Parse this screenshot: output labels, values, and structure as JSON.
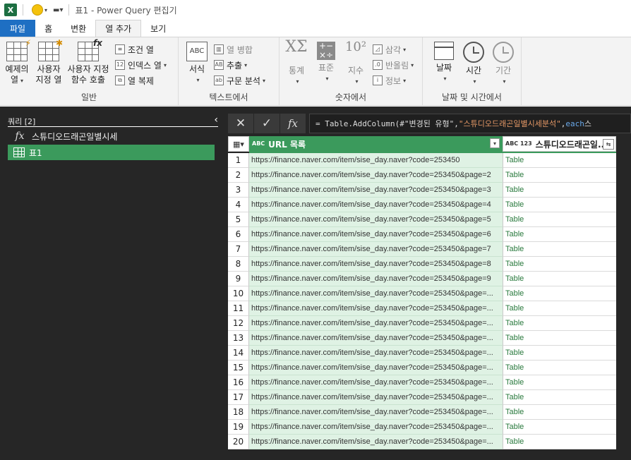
{
  "titlebar": {
    "app_icon": "X",
    "title": "표1 - Power Query 편집기"
  },
  "tabs": [
    {
      "label": "파일"
    },
    {
      "label": "홈"
    },
    {
      "label": "변환"
    },
    {
      "label": "열 추가"
    },
    {
      "label": "보기"
    }
  ],
  "ribbon": {
    "general": {
      "label": "일반",
      "example_col": [
        "예제의",
        "열"
      ],
      "custom_col": [
        "사용자",
        "지정 열"
      ],
      "invoke_func": [
        "사용자 지정",
        "함수 호출"
      ],
      "cond_col": "조건 열",
      "index_col": "인덱스 열",
      "dup_col": "열 복제"
    },
    "text": {
      "label": "텍스트에서",
      "format": "서식",
      "merge": "열 병합",
      "extract": "추출",
      "parse": "구문 분석",
      "abc_icon": "ABC"
    },
    "number": {
      "label": "숫자에서",
      "stats": "통계",
      "standard": "표준",
      "scientific": "지수",
      "trig": "삼각",
      "round": "반올림",
      "info": "정보",
      "sigma_icon": "XΣ",
      "pow_icon": "10²"
    },
    "datetime": {
      "label": "날짜 및 시간에서",
      "date": "날짜",
      "time": "시간",
      "duration": "기간"
    }
  },
  "queries": {
    "header": "쿼리 [2]",
    "items": [
      {
        "icon": "fx",
        "name": "스튜디오드래곤일별시세"
      },
      {
        "icon": "table",
        "name": "표1"
      }
    ]
  },
  "formula_bar": {
    "prefix": "= Table.AddColumn(#\"변경된 유형\", ",
    "string": "\"스튜디오드래곤일별시세분석\"",
    "sep": ", ",
    "keyword": "each",
    "suffix": " 스"
  },
  "grid": {
    "col1": {
      "type": "ABC",
      "name": "URL 목록"
    },
    "col2": {
      "type": "ABC 123",
      "name": "스튜디오드래곤일..."
    },
    "rows": [
      {
        "n": "1",
        "url": "https://finance.naver.com/item/sise_day.naver?code=253450",
        "val": "Table"
      },
      {
        "n": "2",
        "url": "https://finance.naver.com/item/sise_day.naver?code=253450&page=2",
        "val": "Table"
      },
      {
        "n": "3",
        "url": "https://finance.naver.com/item/sise_day.naver?code=253450&page=3",
        "val": "Table"
      },
      {
        "n": "4",
        "url": "https://finance.naver.com/item/sise_day.naver?code=253450&page=4",
        "val": "Table"
      },
      {
        "n": "5",
        "url": "https://finance.naver.com/item/sise_day.naver?code=253450&page=5",
        "val": "Table"
      },
      {
        "n": "6",
        "url": "https://finance.naver.com/item/sise_day.naver?code=253450&page=6",
        "val": "Table"
      },
      {
        "n": "7",
        "url": "https://finance.naver.com/item/sise_day.naver?code=253450&page=7",
        "val": "Table"
      },
      {
        "n": "8",
        "url": "https://finance.naver.com/item/sise_day.naver?code=253450&page=8",
        "val": "Table"
      },
      {
        "n": "9",
        "url": "https://finance.naver.com/item/sise_day.naver?code=253450&page=9",
        "val": "Table"
      },
      {
        "n": "10",
        "url": "https://finance.naver.com/item/sise_day.naver?code=253450&page=...",
        "val": "Table"
      },
      {
        "n": "11",
        "url": "https://finance.naver.com/item/sise_day.naver?code=253450&page=...",
        "val": "Table"
      },
      {
        "n": "12",
        "url": "https://finance.naver.com/item/sise_day.naver?code=253450&page=...",
        "val": "Table"
      },
      {
        "n": "13",
        "url": "https://finance.naver.com/item/sise_day.naver?code=253450&page=...",
        "val": "Table"
      },
      {
        "n": "14",
        "url": "https://finance.naver.com/item/sise_day.naver?code=253450&page=...",
        "val": "Table"
      },
      {
        "n": "15",
        "url": "https://finance.naver.com/item/sise_day.naver?code=253450&page=...",
        "val": "Table"
      },
      {
        "n": "16",
        "url": "https://finance.naver.com/item/sise_day.naver?code=253450&page=...",
        "val": "Table"
      },
      {
        "n": "17",
        "url": "https://finance.naver.com/item/sise_day.naver?code=253450&page=...",
        "val": "Table"
      },
      {
        "n": "18",
        "url": "https://finance.naver.com/item/sise_day.naver?code=253450&page=...",
        "val": "Table"
      },
      {
        "n": "19",
        "url": "https://finance.naver.com/item/sise_day.naver?code=253450&page=...",
        "val": "Table"
      },
      {
        "n": "20",
        "url": "https://finance.naver.com/item/sise_day.naver?code=253450&page=...",
        "val": "Table"
      }
    ]
  },
  "colors": {
    "accent_green": "#3b9a5c",
    "file_blue": "#1e6fc3",
    "dark_pane": "#262626"
  }
}
